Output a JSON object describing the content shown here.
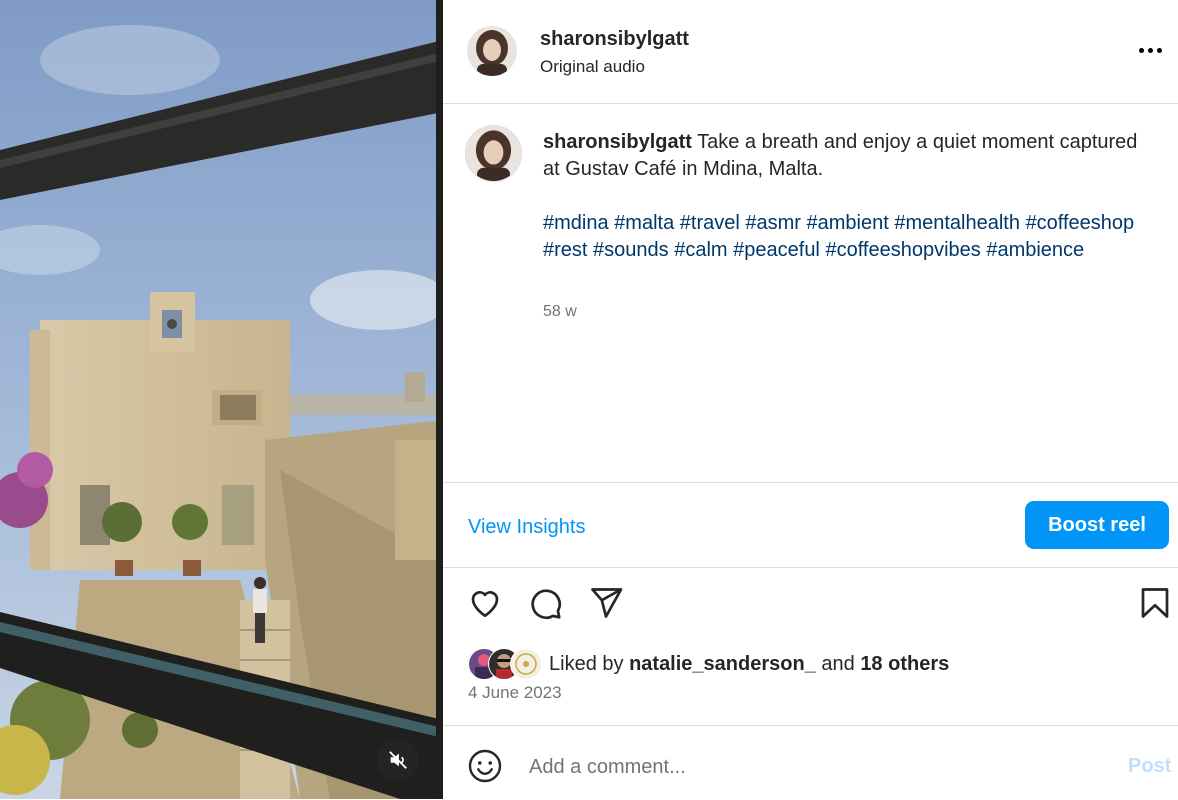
{
  "post": {
    "username": "sharonsibylgatt",
    "audio": "Original audio",
    "caption_text": "Take a breath and enjoy a quiet moment captured at Gustav Café in Mdina, Malta.",
    "hashtags": [
      "#mdina",
      "#malta",
      "#travel",
      "#asmr",
      "#ambient",
      "#mentalhealth",
      "#coffeeshop",
      "#rest",
      "#sounds",
      "#calm",
      "#peaceful",
      "#coffeeshopvibes",
      "#ambience"
    ],
    "age": "58 w",
    "date": "4 June 2023"
  },
  "actions": {
    "view_insights": "View Insights",
    "boost": "Boost reel"
  },
  "likes": {
    "prefix": "Liked by",
    "user": "natalie_sanderson_",
    "joiner": "and",
    "others": "18 others"
  },
  "comment": {
    "placeholder": "Add a comment...",
    "post_label": "Post"
  },
  "icons": {
    "more": "more-horizontal-icon",
    "like": "heart-icon",
    "comment": "comment-icon",
    "share": "share-paper-plane-icon",
    "save": "bookmark-icon",
    "emoji": "emoji-smile-icon",
    "mute": "audio-muted-icon"
  },
  "colors": {
    "link": "#0095f6",
    "hashtag": "#00376b",
    "muted_text": "#737373",
    "border": "#dbdbdb",
    "post_disabled": "#c0dffd"
  }
}
